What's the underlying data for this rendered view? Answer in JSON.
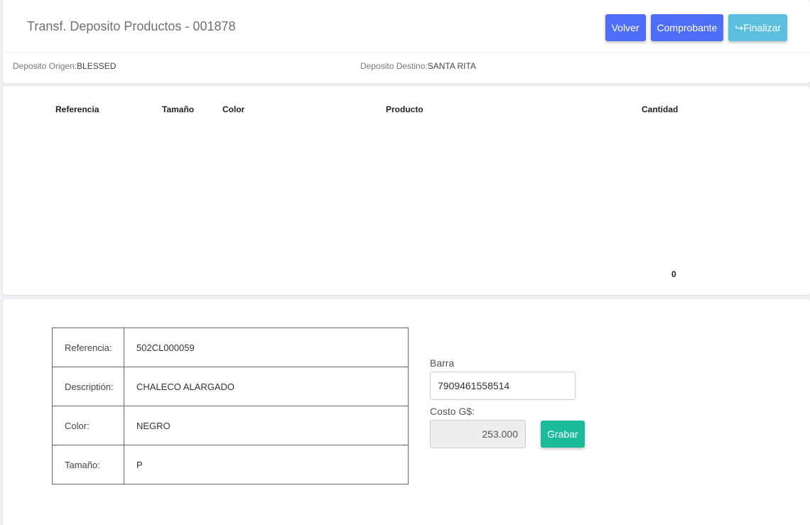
{
  "header": {
    "title": "Transf. Deposito Productos - 001878",
    "buttons": {
      "volver": "Volver",
      "comprobante": "Comprobante",
      "finalizar": "Finalizar"
    },
    "origin_label": "Deposito Origen:",
    "origin_value": "BLESSED",
    "dest_label": "Deposito Destino:",
    "dest_value": "SANTA RITA"
  },
  "table": {
    "columns": [
      "Referencia",
      "Tamaño",
      "Color",
      "Producto",
      "Cantidad"
    ],
    "rows": [],
    "total_quantity": "0"
  },
  "detail": {
    "rows": [
      {
        "label": "Referencia:",
        "value": "502CL000059"
      },
      {
        "label": "Descriptión:",
        "value": "CHALECO ALARGADO"
      },
      {
        "label": "Color:",
        "value": "NEGRO"
      },
      {
        "label": "Tamaño:",
        "value": "P"
      }
    ]
  },
  "form": {
    "barcode_label": "Barra",
    "barcode_value": "7909461558514",
    "cost_label": "Costo G$:",
    "cost_value": "253.000",
    "save_label": "Grabar"
  },
  "colors": {
    "primary": "#4f6ef7",
    "info": "#5bc0de",
    "success": "#1abc9c"
  },
  "icons": {
    "finalizar": "share-arrow-icon"
  }
}
